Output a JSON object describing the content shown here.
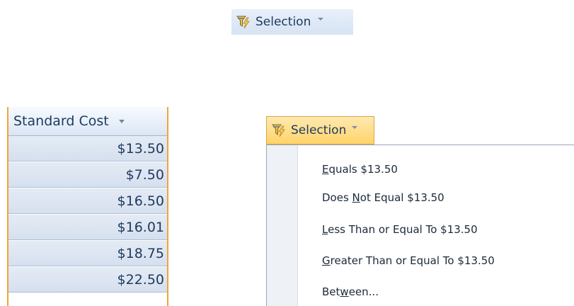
{
  "ribbon": {
    "selection_label": "Selection"
  },
  "column": {
    "header": "Standard Cost",
    "rows": [
      "$13.50",
      "$7.50",
      "$16.50",
      "$16.01",
      "$18.75",
      "$22.50"
    ]
  },
  "menu": {
    "button_label": "Selection",
    "items": [
      {
        "pre": "",
        "accel": "E",
        "post": "quals $13.50"
      },
      {
        "pre": "Does ",
        "accel": "N",
        "post": "ot Equal $13.50"
      },
      {
        "pre": "",
        "accel": "L",
        "post": "ess Than or Equal To $13.50"
      },
      {
        "pre": "",
        "accel": "G",
        "post": "reater Than or Equal To $13.50"
      },
      {
        "pre": "Bet",
        "accel": "w",
        "post": "een..."
      }
    ]
  },
  "icons": {
    "selection": "filter-lightning-icon"
  }
}
